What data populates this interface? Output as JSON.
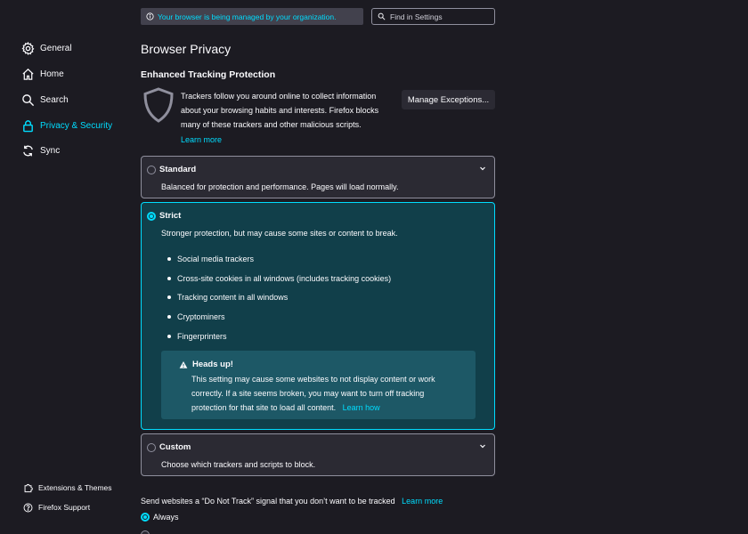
{
  "sidebar": {
    "items": [
      {
        "label": "General",
        "icon": "gear-icon"
      },
      {
        "label": "Home",
        "icon": "home-icon"
      },
      {
        "label": "Search",
        "icon": "search-icon"
      },
      {
        "label": "Privacy & Security",
        "icon": "lock-icon",
        "active": true
      },
      {
        "label": "Sync",
        "icon": "sync-icon"
      }
    ],
    "footer": [
      {
        "label": "Extensions & Themes",
        "icon": "puzzle-icon"
      },
      {
        "label": "Firefox Support",
        "icon": "help-icon"
      }
    ]
  },
  "managed_notice": "Your browser is being managed by your organization.",
  "search": {
    "placeholder": "Find in Settings"
  },
  "page_title": "Browser Privacy",
  "etp": {
    "title": "Enhanced Tracking Protection",
    "description": "Trackers follow you around online to collect information about your browsing habits and interests. Firefox blocks many of these trackers and other malicious scripts.",
    "learn_more": "Learn more",
    "manage_exceptions": "Manage Exceptions..."
  },
  "options": {
    "standard": {
      "label": "Standard",
      "description": "Balanced for protection and performance. Pages will load normally."
    },
    "strict": {
      "label": "Strict",
      "description": "Stronger protection, but may cause some sites or content to break.",
      "bullets": [
        "Social media trackers",
        "Cross-site cookies in all windows (includes tracking cookies)",
        "Tracking content in all windows",
        "Cryptominers",
        "Fingerprinters"
      ],
      "warning": {
        "title": "Heads up!",
        "text": "This setting may cause some websites to not display content or work correctly. If a site seems broken, you may want to turn off tracking protection for that site to load all content.",
        "learn_how": "Learn how"
      }
    },
    "custom": {
      "label": "Custom",
      "description": "Choose which trackers and scripts to block."
    }
  },
  "dnt": {
    "text": "Send websites a “Do Not Track” signal that you don’t want to be tracked",
    "learn_more": "Learn more",
    "always": "Always"
  },
  "colors": {
    "accent": "#00ddff",
    "background": "#1c1b22",
    "card": "#2b2a33",
    "selected_card": "#113f4a"
  }
}
